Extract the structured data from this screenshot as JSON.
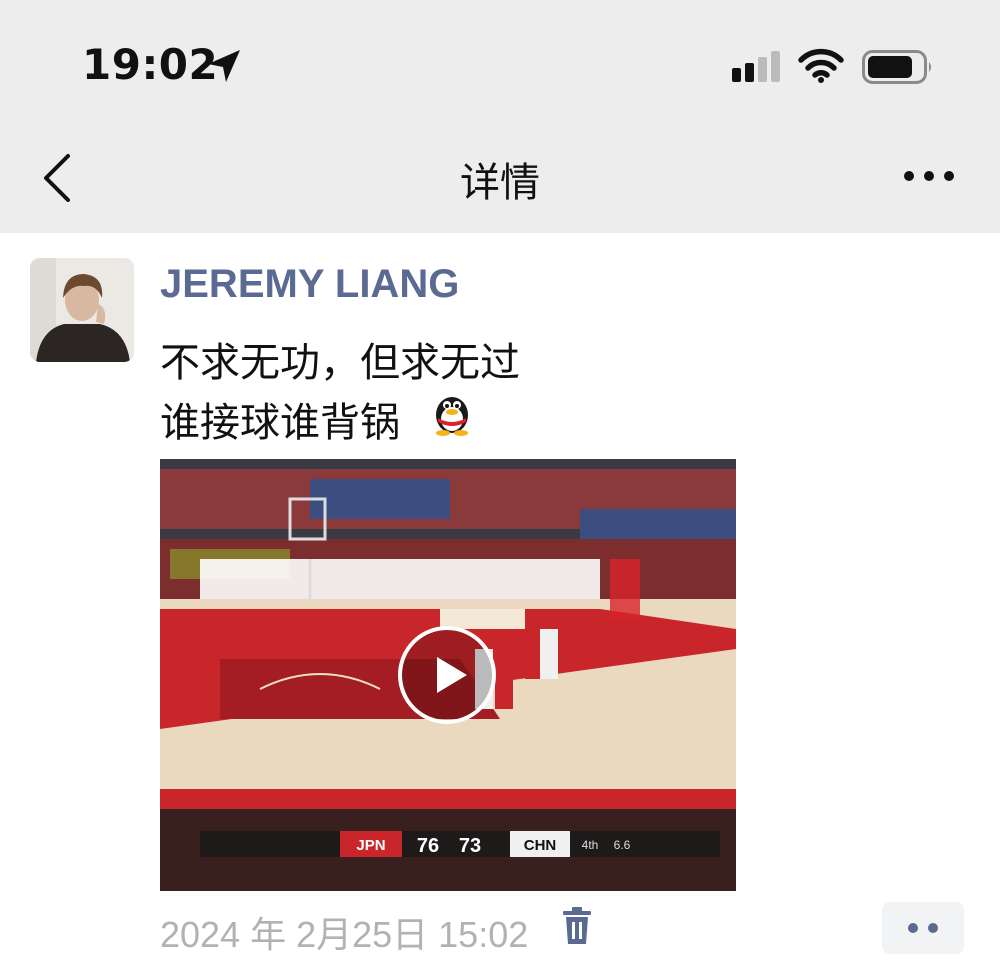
{
  "status_bar": {
    "time": "19:02",
    "icons": [
      "location-arrow-icon",
      "cellular-signal-icon",
      "wifi-icon",
      "battery-icon"
    ]
  },
  "nav": {
    "title": "详情",
    "back_icon": "chevron-left-icon",
    "more_icon": "more-dots-icon"
  },
  "post": {
    "author": "JEREMY LIANG",
    "lines": [
      "不求无功，但求无过",
      "谁接球谁背锅"
    ],
    "emoji": "qq-penguin-emoji",
    "video": {
      "type": "video",
      "scoreboard": {
        "team_left": "JPN",
        "score_left": "76",
        "score_right": "73",
        "team_right": "CHN",
        "period": "4th",
        "clock": "6.6"
      }
    },
    "timestamp": "2024 年 2月25日 15:02",
    "delete_icon": "trash-icon",
    "comment_icon": "comment-dots-icon"
  },
  "colors": {
    "nav_background": "#ededed",
    "author_name": "#5b6a92",
    "timestamp": "#b2b2b2",
    "court_red": "#c9262b",
    "court_wood": "#ead9bf"
  }
}
